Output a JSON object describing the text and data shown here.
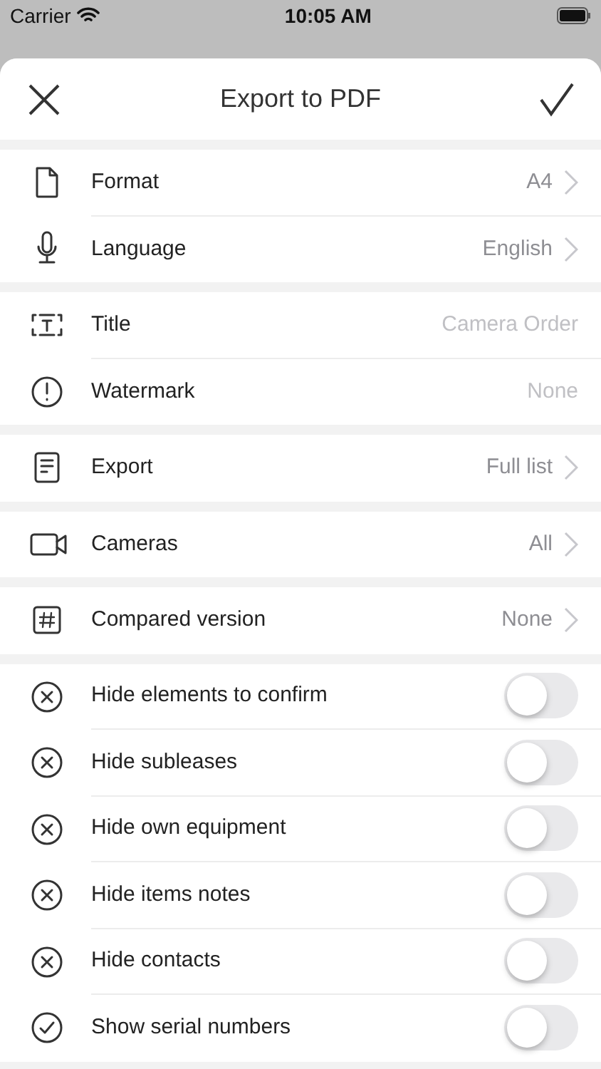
{
  "status_bar": {
    "carrier": "Carrier",
    "time": "10:05 AM"
  },
  "sheet": {
    "title": "Export to PDF"
  },
  "sections": [
    {
      "rows": [
        {
          "kind": "nav",
          "label": "Format",
          "value": "A4"
        },
        {
          "kind": "nav",
          "label": "Language",
          "value": "English"
        }
      ]
    },
    {
      "rows": [
        {
          "kind": "text",
          "label": "Title",
          "placeholder": "Camera Order"
        },
        {
          "kind": "text",
          "label": "Watermark",
          "placeholder": "None"
        }
      ]
    },
    {
      "rows": [
        {
          "kind": "nav",
          "label": "Export",
          "value": "Full list"
        }
      ]
    },
    {
      "rows": [
        {
          "kind": "nav",
          "label": "Cameras",
          "value": "All"
        }
      ]
    },
    {
      "rows": [
        {
          "kind": "nav",
          "label": "Compared version",
          "value": "None"
        }
      ]
    },
    {
      "rows": [
        {
          "kind": "toggle",
          "label": "Hide elements to confirm",
          "on": false
        },
        {
          "kind": "toggle",
          "label": "Hide subleases",
          "on": false
        },
        {
          "kind": "toggle",
          "label": "Hide own equipment",
          "on": false
        },
        {
          "kind": "toggle",
          "label": "Hide items notes",
          "on": false
        },
        {
          "kind": "toggle",
          "label": "Hide contacts",
          "on": false
        },
        {
          "kind": "toggle",
          "label": "Show serial numbers",
          "on": false
        }
      ]
    }
  ]
}
